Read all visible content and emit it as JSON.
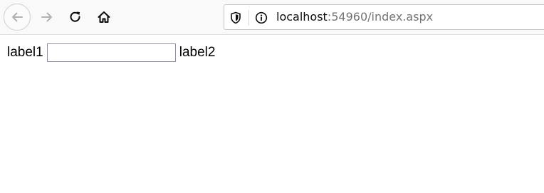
{
  "browser": {
    "toolbar": {
      "back_icon": "arrow-left-icon",
      "forward_icon": "arrow-right-icon",
      "reload_icon": "reload-icon",
      "home_icon": "home-icon"
    },
    "urlbar": {
      "host": "localhost",
      "rest": ":54960/index.aspx",
      "shield_icon": "tracking-protection-shield-icon",
      "info_icon": "site-info-icon"
    }
  },
  "page": {
    "label1": "label1",
    "textbox_value": "",
    "label2": "label2"
  }
}
